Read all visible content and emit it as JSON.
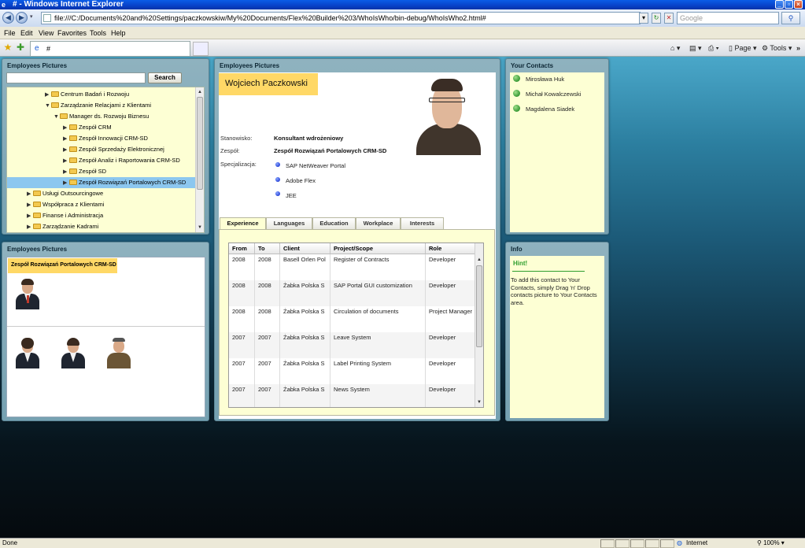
{
  "window": {
    "title": "# - Windows Internet Explorer"
  },
  "address": {
    "url": "file:///C:/Documents%20and%20Settings/paczkowskiw/My%20Documents/Flex%20Builder%203/WhoIsWho/bin-debug/WhoIsWho2.html#"
  },
  "search": {
    "placeholder": "Google"
  },
  "menu": [
    "File",
    "Edit",
    "View",
    "Favorites",
    "Tools",
    "Help"
  ],
  "tab": {
    "label": "#"
  },
  "commands": {
    "page": "Page",
    "tools": "Tools"
  },
  "tree_panel": {
    "title": "Employees Pictures",
    "search_value": "",
    "search_button": "Search",
    "items": [
      {
        "label": "Centrum Badań i Rozwoju",
        "expanded": false,
        "selected": false
      },
      {
        "label": "Zarządzanie Relacjami z Klientami",
        "expanded": true,
        "selected": false
      },
      {
        "label": "Manager ds. Rozwoju Biznesu",
        "expanded": true,
        "selected": false
      },
      {
        "label": "Zespół CRM",
        "expanded": false,
        "selected": false
      },
      {
        "label": "Zespół Innowacji CRM-SD",
        "expanded": false,
        "selected": false
      },
      {
        "label": "Zespół Sprzedaży Elektronicznej",
        "expanded": false,
        "selected": false
      },
      {
        "label": "Zespół Analiz i Raportowania CRM-SD",
        "expanded": false,
        "selected": false
      },
      {
        "label": "Zespół SD",
        "expanded": false,
        "selected": false
      },
      {
        "label": "Zespół Rozwiązań Portalowych CRM-SD",
        "expanded": false,
        "selected": true
      },
      {
        "label": "Usługi Outsourcingowe",
        "expanded": false,
        "selected": false
      },
      {
        "label": "Współpraca z Klientami",
        "expanded": false,
        "selected": false
      },
      {
        "label": "Finanse i Administracja",
        "expanded": false,
        "selected": false
      },
      {
        "label": "Zarządzanie Kadrami",
        "expanded": false,
        "selected": false
      }
    ]
  },
  "team_panel": {
    "title": "Employees Pictures",
    "team_name": "Zespół Rozwiązań Portalowych CRM-SD"
  },
  "profile": {
    "panel_title": "Employees Pictures",
    "name": "Wojciech Paczkowski",
    "position_label": "Stanowisko:",
    "position_value": "Konsultant wdrożeniowy",
    "team_label": "Zespół:",
    "team_value": "Zespół Rozwiązań Portalowych CRM-SD",
    "spec_label": "Specjalizacja:",
    "specializations": [
      "SAP NetWeaver Portal",
      "Adobe Flex",
      "JEE"
    ],
    "tabs": [
      "Experience",
      "Languages",
      "Education",
      "Workplace",
      "Interests"
    ],
    "active_tab": "Experience",
    "columns": [
      "From",
      "To",
      "Client",
      "Project/Scope",
      "Role"
    ],
    "experience": [
      [
        "2008",
        "2008",
        "Basell Orlen Pol",
        "Register of Contracts",
        "Developer"
      ],
      [
        "2008",
        "2008",
        "Żabka Polska S",
        "SAP Portal GUI customization",
        "Developer"
      ],
      [
        "2008",
        "2008",
        "Żabka Polska S",
        "Circulation of documents",
        "Project Manager"
      ],
      [
        "2007",
        "2007",
        "Żabka Polska S",
        "Leave System",
        "Developer"
      ],
      [
        "2007",
        "2007",
        "Żabka Polska S",
        "Label Printing System",
        "Developer"
      ],
      [
        "2007",
        "2007",
        "Żabka Polska S",
        "News System",
        "Developer"
      ]
    ]
  },
  "contacts_panel": {
    "title": "Your Contacts",
    "contacts": [
      "Mirosława Huk",
      "Michał Kowalczewski",
      "Magdalena Siadek"
    ]
  },
  "info_panel": {
    "title": "Info",
    "hint_title": "Hint!",
    "hint_text": "To add this contact to Your Contacts, simply Drag 'n' Drop contacts picture to Your Contacts area."
  },
  "status": {
    "left": "Done",
    "zone": "Internet",
    "zoom": "100%"
  }
}
